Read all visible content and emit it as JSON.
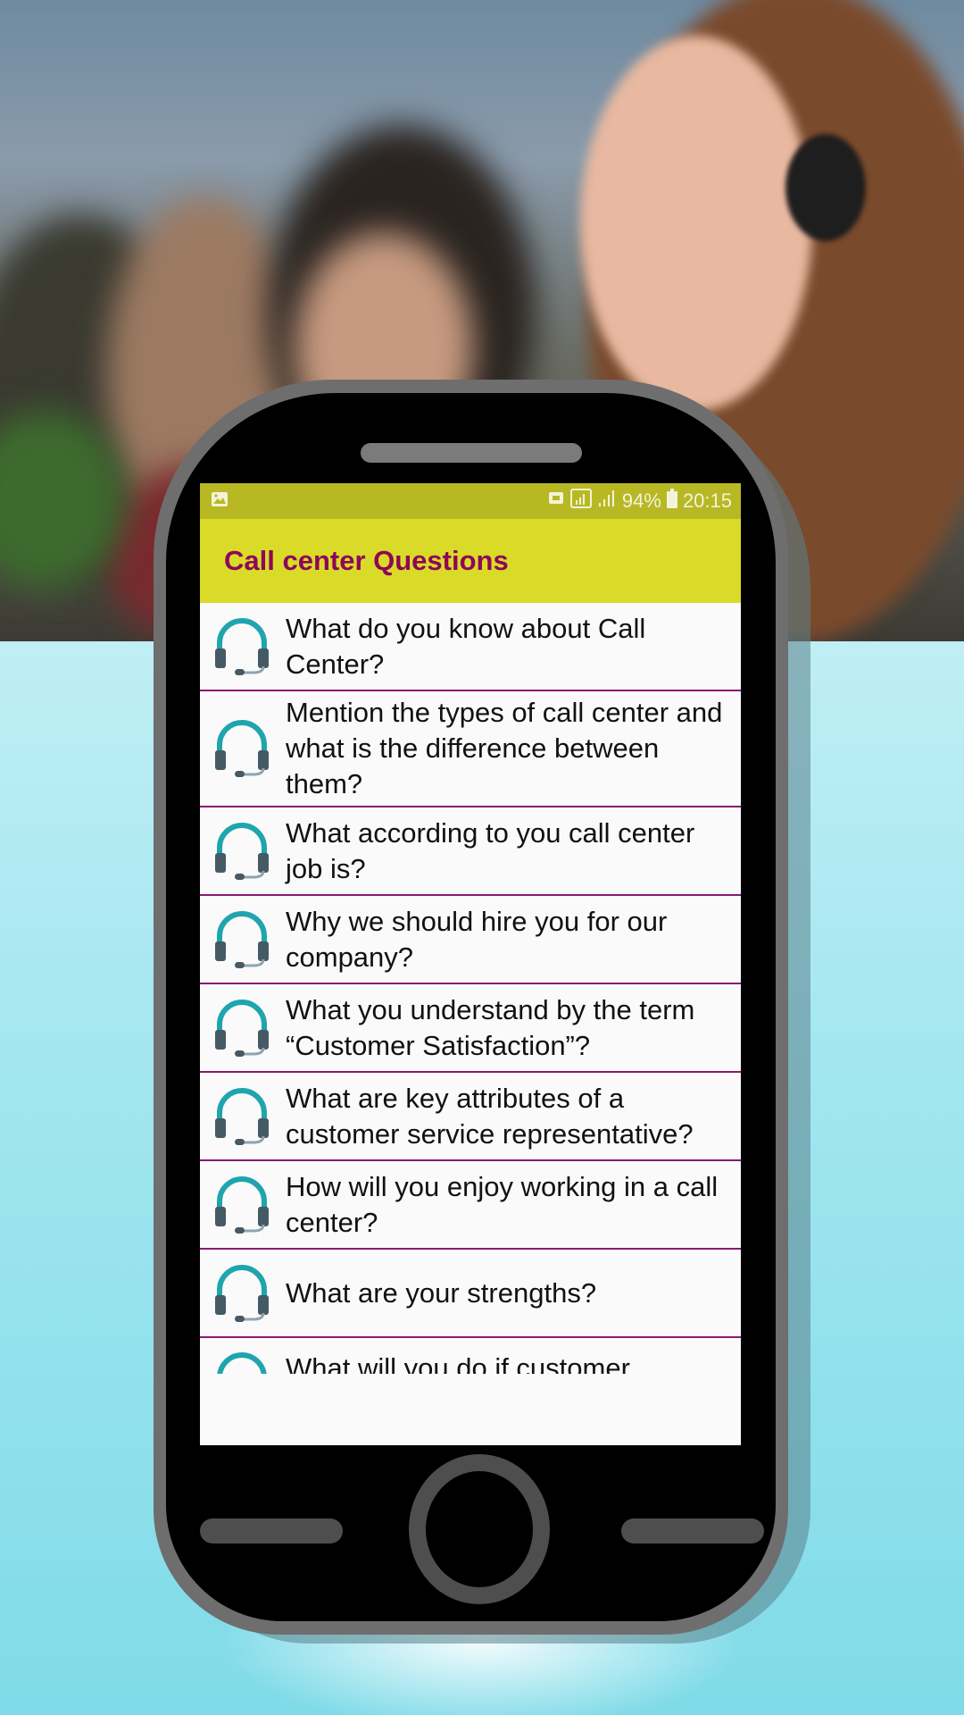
{
  "status_bar": {
    "left_icon": "image-notification-icon",
    "icons": [
      "message-icon",
      "signal-box-icon",
      "signal-bars-icon"
    ],
    "battery_percent": "94%",
    "battery_icon": "battery-icon",
    "time": "20:15"
  },
  "toolbar": {
    "title": "Call center Questions"
  },
  "colors": {
    "status_bar": "#b8b825",
    "toolbar": "#d9db28",
    "title": "#8e0659",
    "divider": "#8a1a6f",
    "icon_teal": "#1ea5ad",
    "icon_dark": "#455a64"
  },
  "questions": [
    {
      "icon": "headset-icon",
      "text": "What do you know about Call Center?"
    },
    {
      "icon": "headset-icon",
      "text": "Mention the types of call center and what is the difference between them?"
    },
    {
      "icon": "headset-icon",
      "text": "What according to you call center job is?"
    },
    {
      "icon": "headset-icon",
      "text": "Why we should hire you for our company?"
    },
    {
      "icon": "headset-icon",
      "text": "What you understand by the term “Customer Satisfaction”?"
    },
    {
      "icon": "headset-icon",
      "text": "What are key attributes of a customer service representative?"
    },
    {
      "icon": "headset-icon",
      "text": "How will you enjoy working in a call center?"
    },
    {
      "icon": "headset-icon",
      "text": "What are your strengths?"
    },
    {
      "icon": "headset-icon",
      "text": "What will you do if customer"
    }
  ]
}
